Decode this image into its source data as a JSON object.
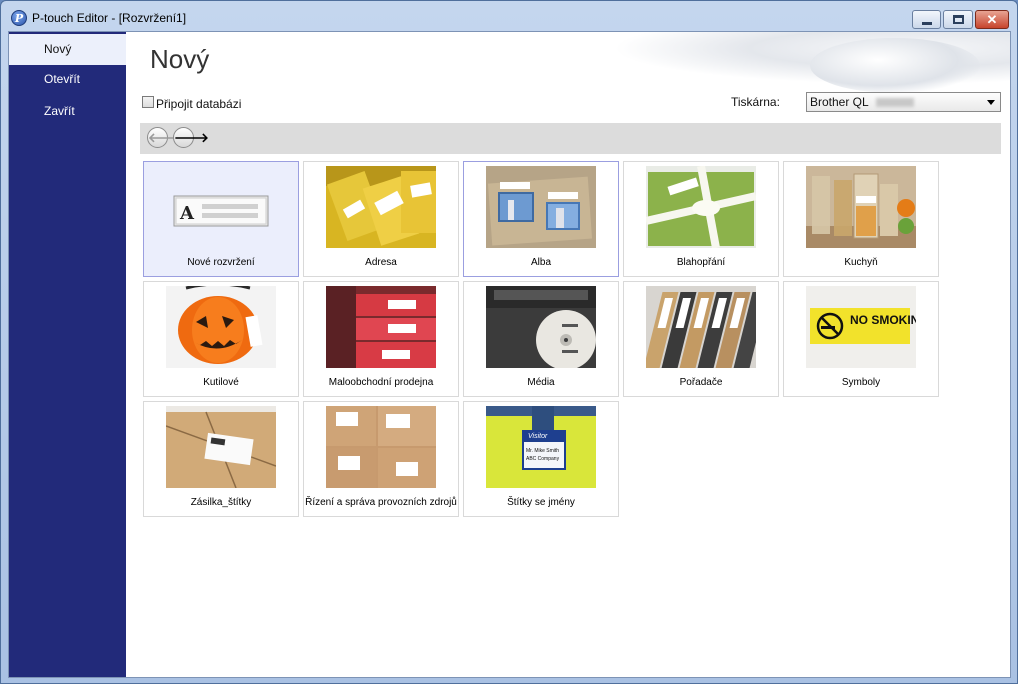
{
  "window": {
    "title": "P-touch Editor - [Rozvržení1]",
    "icon": "p-touch-icon",
    "buttons": {
      "minimize": "minimize-icon",
      "maximize": "maximize-icon",
      "close": "close-icon"
    },
    "close_glyph": "✕"
  },
  "sidebar": {
    "items": [
      {
        "label": "Nový",
        "active": true
      },
      {
        "label": "Otevřít",
        "active": false
      },
      {
        "label": "Zavřít",
        "active": false
      }
    ]
  },
  "main": {
    "title": "Nový",
    "database_checkbox": {
      "label": "Připojit databázi",
      "checked": false
    },
    "printer": {
      "label": "Tiskárna:",
      "value": "Brother QL"
    },
    "nav": {
      "back_glyph": "🡐",
      "forward_glyph": "🡒"
    },
    "templates": [
      {
        "label": "Nové rozvržení",
        "icon": "new-layout-icon",
        "selected": true
      },
      {
        "label": "Adresa",
        "icon": "address-labels-photo"
      },
      {
        "label": "Alba",
        "icon": "album-photo",
        "hover": true
      },
      {
        "label": "Blahopřání",
        "icon": "greeting-gift-photo"
      },
      {
        "label": "Kuchyň",
        "icon": "kitchen-jars-photo"
      },
      {
        "label": "Kutilové",
        "icon": "pumpkin-photo"
      },
      {
        "label": "Maloobchodní prodejna",
        "icon": "retail-boxes-photo"
      },
      {
        "label": "Média",
        "icon": "media-disc-photo"
      },
      {
        "label": "Pořadače",
        "icon": "binders-photo"
      },
      {
        "label": "Symboly",
        "icon": "no-smoking-sign-photo",
        "sign_text": "NO SMOKING"
      },
      {
        "label": "Zásilka_štítky",
        "icon": "parcel-photo"
      },
      {
        "label": "Řízení a správa provozních zdrojů",
        "icon": "warehouse-boxes-photo"
      },
      {
        "label": "Štítky se jmény",
        "icon": "name-badge-photo",
        "badge_title": "Visitor",
        "badge_lines": [
          "Mr. Mike Smith",
          "ABC Company"
        ]
      }
    ]
  },
  "colors": {
    "sidebar_bg": "#222a7a",
    "sidebar_active_bg": "#ecf0fb",
    "selected_tile_bg": "#ebeefc",
    "selected_tile_border": "#9b9fe0",
    "nav_bar_bg": "#dcdcdc"
  }
}
